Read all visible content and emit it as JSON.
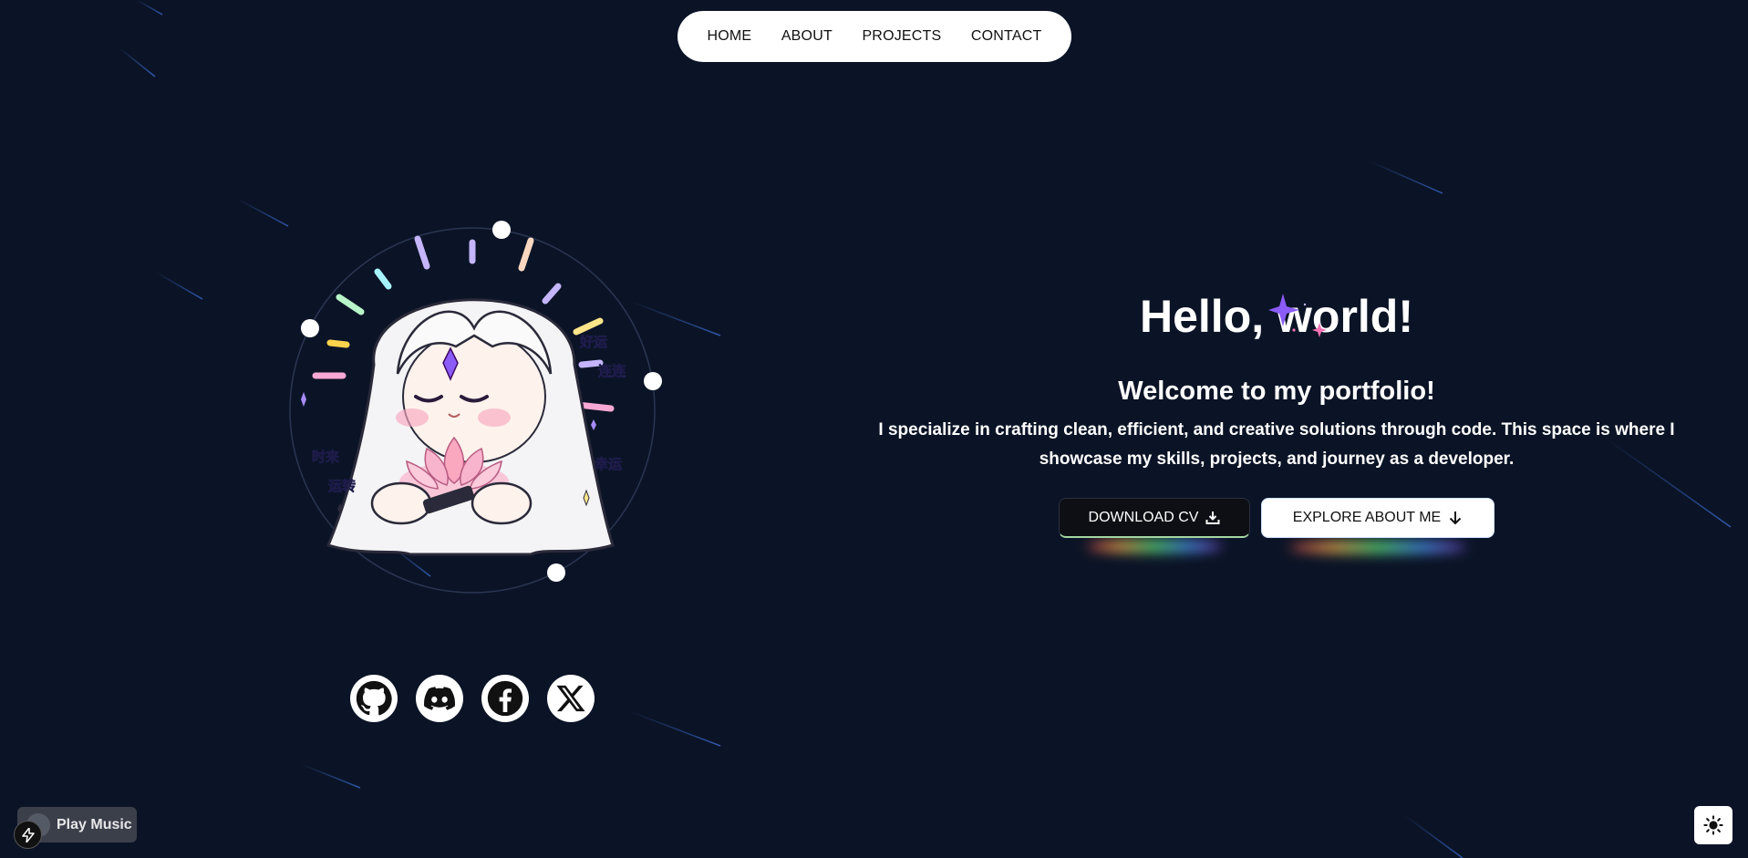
{
  "nav": {
    "items": [
      {
        "label": "HOME"
      },
      {
        "label": "ABOUT"
      },
      {
        "label": "PROJECTS"
      },
      {
        "label": "CONTACT"
      }
    ]
  },
  "avatar": {
    "side_text_left": [
      "时来",
      "运转"
    ],
    "side_text_right": [
      "好运",
      "连连",
      "幸运"
    ]
  },
  "hero": {
    "heading": "Hello, world!",
    "subheading": "Welcome to my portfolio!",
    "description": "I specialize in crafting clean, efficient, and creative solutions through code. This space is where I showcase my skills, projects, and journey as a developer.",
    "download_label": "DOWNLOAD CV",
    "explore_label": "EXPLORE ABOUT ME"
  },
  "socials": [
    {
      "icon": "github-icon"
    },
    {
      "icon": "discord-icon"
    },
    {
      "icon": "facebook-icon"
    },
    {
      "icon": "x-icon"
    }
  ],
  "music": {
    "label": "Play Music"
  },
  "colors": {
    "background": "#0b1426",
    "nav_bg": "#ffffff",
    "accent_purple": "#8b5cf6",
    "accent_pink": "#f9a8d4"
  }
}
